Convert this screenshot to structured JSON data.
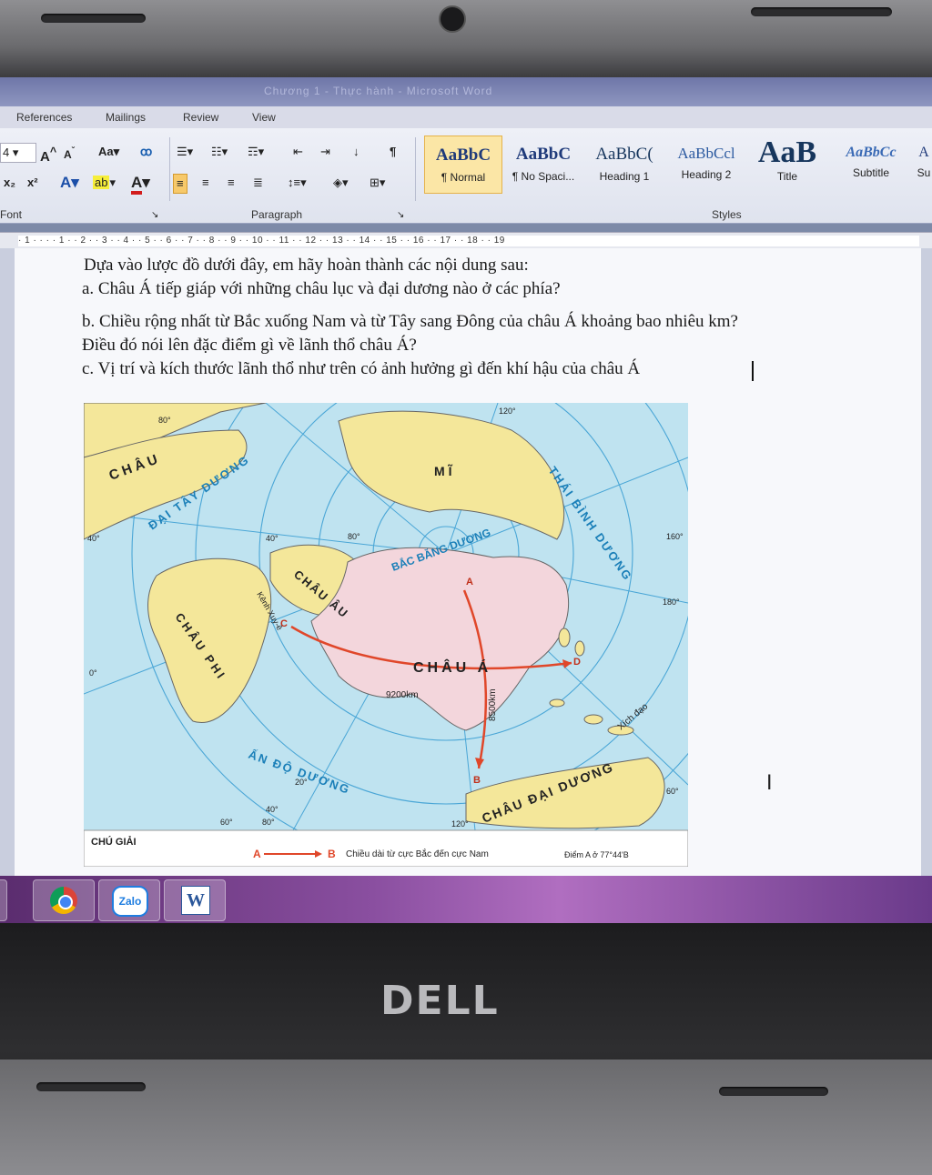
{
  "window": {
    "title": "Chương 1 - Thực hành - Microsoft Word"
  },
  "ribbon_tabs": [
    "References",
    "Mailings",
    "Review",
    "View"
  ],
  "font_group": {
    "size": "4",
    "grow": "A",
    "shrink": "A",
    "case": "Aa",
    "label": "Font"
  },
  "paragraph_group": {
    "label": "Paragraph",
    "pilcrow": "¶"
  },
  "styles_group": {
    "label": "Styles",
    "items": [
      {
        "sample": "AaBbC",
        "name": "¶ Normal"
      },
      {
        "sample": "AaBbC",
        "name": "¶ No Spaci..."
      },
      {
        "sample": "AaBbC(",
        "name": "Heading 1"
      },
      {
        "sample": "AaBbCcl",
        "name": "Heading 2"
      },
      {
        "sample": "AaB",
        "name": "Title"
      },
      {
        "sample": "AaBbCc",
        "name": "Subtitle"
      },
      {
        "sample": "A",
        "name": "Su"
      }
    ]
  },
  "ruler": {
    "text": "· 1 · · · · 1 · · 2 · · 3 · · 4 · · 5 · · 6 · · 7 · · 8 · · 9 · · 10 · · 11 · · 12 · · 13 · · 14 · · 15 · · 16 · · 17 · · 18 · · 19"
  },
  "document": {
    "lines": [
      "Dựa vào lược đồ dưới đây, em hãy hoàn thành các nội dung sau:",
      "a. Châu Á tiếp giáp với những châu lục và đại dương nào ở các phía?",
      "b. Chiều rộng nhất từ Bắc xuống Nam và từ Tây sang Đông của châu Á khoảng bao nhiêu km?",
      "Điều đó nói lên đặc điểm gì về lãnh thổ châu Á?",
      "c. Vị trí và kích thước lãnh thổ như trên có ảnh hưởng gì đến khí hậu của châu Á"
    ]
  },
  "map": {
    "labels": {
      "chau_my_left": "CHÂU",
      "chau_my": "MĨ",
      "dai_tay_duong": "ĐẠI TÂY DƯƠNG",
      "thai_binh_duong": "THÁI BÌNH DƯƠNG",
      "bac_bang_duong": "BẮC BĂNG DƯƠNG",
      "chau_au": "CHÂU ÂU",
      "chau_phi": "CHÂU PHI",
      "kenh_xuyê": "Kênh Xuy-ê",
      "chau_a": "CHÂU Á",
      "dist_ew": "9200km",
      "dist_ns": "8500km",
      "an_do_duong": "ẤN ĐỘ DƯƠNG",
      "xich_dao": "Xích đạo",
      "chau_dai_duong": "CHÂU ĐẠI DƯƠNG",
      "point_a": "A",
      "point_b": "B",
      "point_c": "C",
      "point_d": "D"
    },
    "degrees": [
      "80°",
      "120°",
      "40°",
      "40°",
      "80°",
      "160°",
      "180°",
      "0°",
      "20°",
      "40°",
      "60°",
      "80°",
      "120°",
      "60°"
    ],
    "legend": {
      "title": "CHÚ GIẢI",
      "a": "A",
      "b": "B",
      "desc": "Chiều dài từ cực Bắc đến cực Nam",
      "point": "Điểm A ở 77°44'B"
    }
  },
  "taskbar": {
    "apps": [
      {
        "name": "Chrome",
        "glyph": ""
      },
      {
        "name": "Zalo",
        "glyph": "Zalo"
      },
      {
        "name": "Word",
        "glyph": "W"
      }
    ]
  },
  "laptop": {
    "brand": "DELL"
  },
  "colors": {
    "ocean": "#bfe3f0",
    "land": "#f4e79a",
    "asia": "#f3d6dc",
    "route": "#e0472a",
    "ocean_text": "#1a7fb8"
  }
}
